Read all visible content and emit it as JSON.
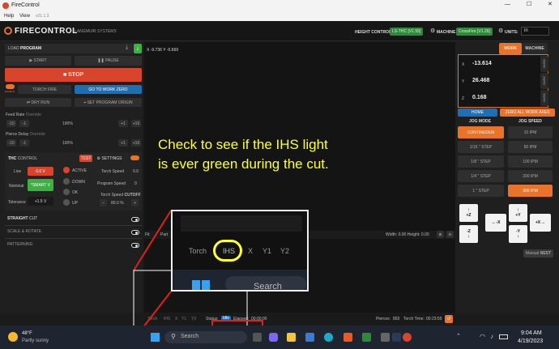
{
  "window": {
    "title": "FireControl",
    "menu": [
      "Help",
      "View"
    ],
    "version": "v21.1.3"
  },
  "brand": {
    "name": "FIRECONTROL",
    "sub": "LANGMUIR SYSTEMS"
  },
  "header": {
    "height_control_label": "HEIGHT CONTROL:",
    "height_control_value": "LS-THC  [V1.55]",
    "machine_label": "MACHINE",
    "machine_value": "CrossFire  [V1.26]",
    "units_label": "UNITS:",
    "units_value": "in"
  },
  "program": {
    "load": "LOAD",
    "load_bold": "PROGRAM",
    "start": "START",
    "pause": "PAUSE",
    "stop": "STOP",
    "enable": "ENABLE",
    "torch_fire": "TORCH FIRE",
    "go_work_zero": "GO TO WORK ZERO",
    "dry_run": "DRY RUN",
    "set_origin": "SET PROGRAM ORIGIN"
  },
  "feed": {
    "label": "Feed Rate",
    "override": "Override",
    "minus10": "-10",
    "minus1": "-1",
    "value": "100%",
    "plus1": "+1",
    "plus10": "+10"
  },
  "pierce": {
    "label": "Pierce Delay",
    "override": "Override",
    "minus10": "-10",
    "minus1": "-1",
    "value": "100%",
    "plus1": "+1",
    "plus10": "+10"
  },
  "thc": {
    "title": "THC",
    "title2": "CONTROL",
    "test": "TEST",
    "settings": "SETTINGS",
    "live": "Live",
    "live_value": "0.0 V",
    "nominal": "Nominal",
    "nominal_value": "*SMART V",
    "tolerance": "Tolerance",
    "tolerance_value": "+1.5  V",
    "active": "ACTIVE",
    "down": "DOWN",
    "ok": "OK",
    "up": "UP",
    "torch_speed": "Torch Speed",
    "torch_speed_value": "0.0",
    "program_speed": "Program Speed",
    "program_speed_value": "0",
    "torch_speed2": "Torch Speed",
    "cutoff": "CUTOFF",
    "cutoff_value": "80.0 %",
    "cutoff_minus": "–",
    "cutoff_plus": "+"
  },
  "sections": {
    "straight": "STRAIGHT",
    "straight2": "CUT",
    "scale": "SCALE & ROTATE",
    "patterning": "PATTERNING"
  },
  "viewport": {
    "coords": "X  -9.736   Y  -0.669",
    "fit": "Fit",
    "part": "Part",
    "width_label": "Width:",
    "width_value": "0.00",
    "height_label": "Height:",
    "height_value": "0.00"
  },
  "annotation": {
    "text": "Check to see if the IHS light is ever green during the cut."
  },
  "zoom": {
    "tabs": [
      "Torch",
      "IHS",
      "X",
      "Y1",
      "Y2"
    ],
    "search": "Search"
  },
  "status": {
    "tabs": [
      "Torch",
      "IHS",
      "X",
      "Y1",
      "Y2"
    ],
    "status_label": "Status:",
    "status_value": "Idle",
    "elapsed_label": "Elapsed:",
    "elapsed_value": "00:00:00",
    "pierces_label": "Pierces:",
    "pierces_value": "893",
    "torch_time_label": "Torch Time:",
    "torch_time_value": "00:23:59"
  },
  "dro": {
    "work": "WORK",
    "machine": "MACHINE",
    "x_label": "X",
    "x_value": "-13.614",
    "y_label": "Y",
    "y_value": "26.468",
    "z_label": "Z",
    "z_value": "0.168",
    "zero": "ZERO",
    "home": "HOME",
    "zero_all": "ZERO ALL WORK AXES"
  },
  "jog": {
    "mode": "JOG MODE",
    "speed": "JOG SPEED",
    "modes": [
      "CONTINUOUS",
      "1/16 \" STEP",
      "1/8 \" STEP",
      "1/4 \" STEP",
      "1 \" STEP"
    ],
    "speeds": [
      "10 IPM",
      "50 IPM",
      "100 IPM",
      "200 IPM",
      "300 IPM"
    ],
    "plus_z": "+Z",
    "minus_z": "-Z",
    "minus_x": "-X",
    "plus_x": "+X",
    "plus_y": "+Y",
    "minus_y": "-Y",
    "manual": "Manual",
    "nest": "NEST"
  },
  "taskbar": {
    "temp": "48°F",
    "weather": "Partly sunny",
    "search": "Search",
    "time": "9:04 AM",
    "date": "4/19/2023"
  },
  "colors": {
    "orange": "#e8732a",
    "green": "#3cb043",
    "red": "#d8452c",
    "annotation": "#ffff33"
  }
}
